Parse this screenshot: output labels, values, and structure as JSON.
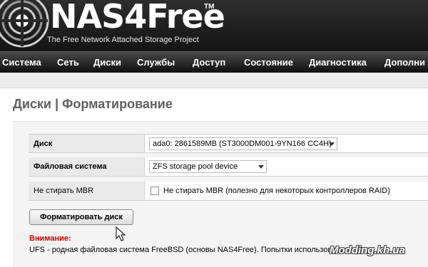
{
  "header": {
    "brand": "NAS4Free",
    "trademark": "TM",
    "tagline": "The Free Network Attached Storage Project"
  },
  "nav": {
    "items": [
      "Система",
      "Сеть",
      "Диски",
      "Службы",
      "Доступ",
      "Состояние",
      "Диагностика",
      "Дополни"
    ]
  },
  "page": {
    "title": "Диски | Форматирование"
  },
  "form": {
    "disk_label": "Диск",
    "disk_value": "ada0: 2861589MB (ST3000DM001-9YN166 CC4H)",
    "fs_label": "Файловая система",
    "fs_value": "ZFS storage pool device",
    "mbr_label": "Не стирать MBR",
    "mbr_checkbox_label": "Не стирать MBR (полезно для некоторых контроллеров RAID)",
    "mbr_checked": false,
    "format_button": "Форматировать диск"
  },
  "notice": {
    "label": "Внимание:",
    "text": "UFS - родная файловая система FreeBSD (основы NAS4Free). Попытки использования"
  },
  "watermark": "Modding.kh.ua",
  "colors": {
    "header_bg": "#1c1c1c",
    "nav_bg": "#2a2a2a",
    "warning": "#cc0000",
    "title": "#5f5f5f"
  }
}
